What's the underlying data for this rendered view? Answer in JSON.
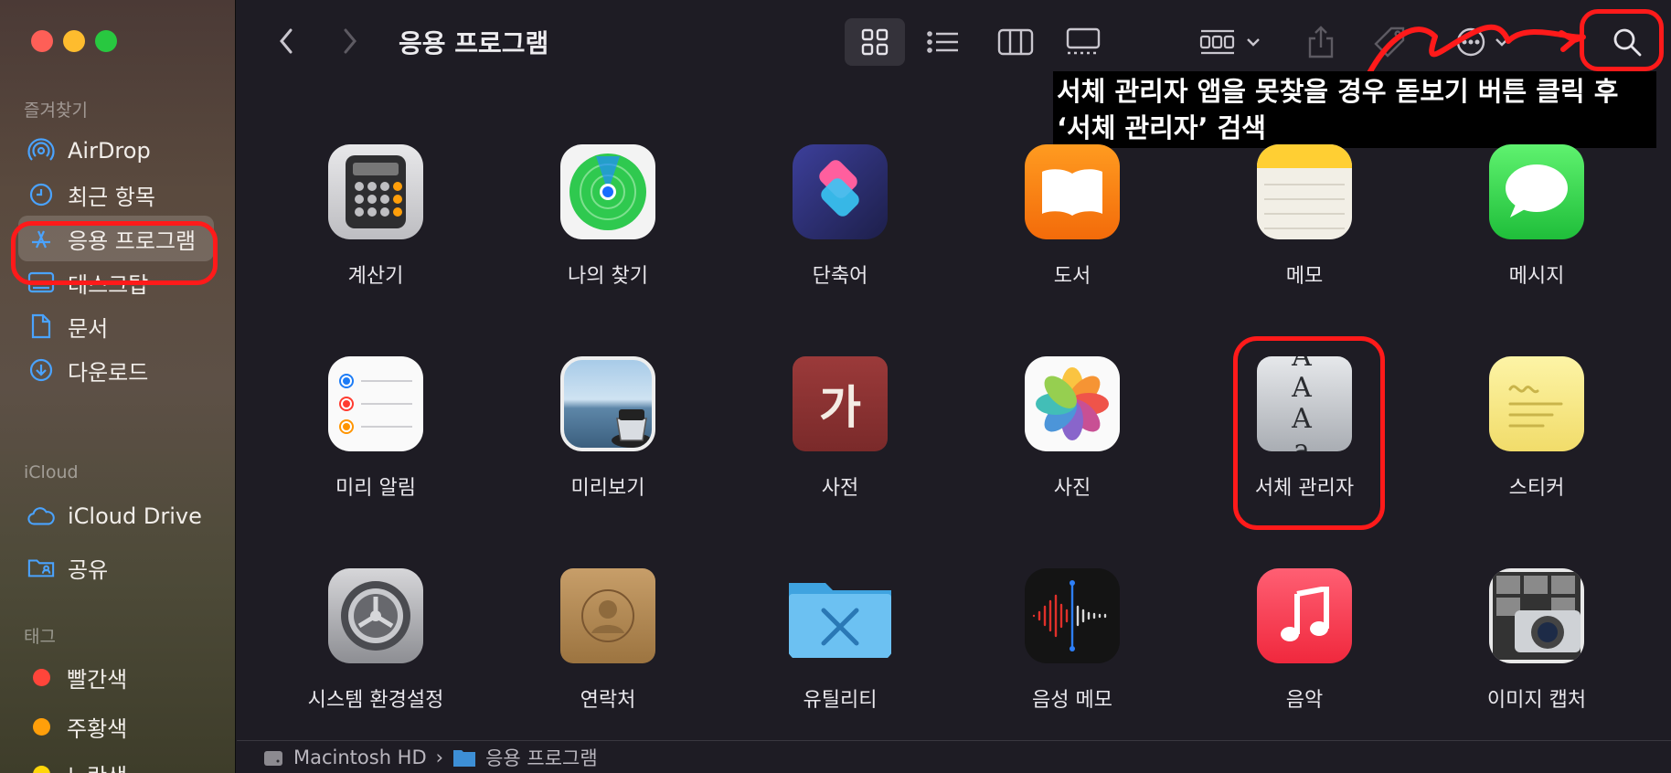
{
  "window": {
    "title": "응용 프로그램"
  },
  "sidebar": {
    "favorites_header": "즐겨찾기",
    "favorites": [
      {
        "label": "AirDrop",
        "icon": "airdrop-icon"
      },
      {
        "label": "최근 항목",
        "icon": "clock-icon"
      },
      {
        "label": "응용 프로그램",
        "icon": "applications-icon",
        "selected": true
      },
      {
        "label": "데스크탑",
        "icon": "desktop-icon"
      },
      {
        "label": "문서",
        "icon": "document-icon"
      },
      {
        "label": "다운로드",
        "icon": "download-icon"
      }
    ],
    "icloud_header": "iCloud",
    "icloud": [
      {
        "label": "iCloud Drive",
        "icon": "cloud-icon"
      },
      {
        "label": "공유",
        "icon": "shared-folder-icon"
      }
    ],
    "tags_header": "태그",
    "tags": [
      {
        "label": "빨간색",
        "color": "#ff453a"
      },
      {
        "label": "주황색",
        "color": "#ff9f0a"
      },
      {
        "label": "노란색",
        "color": "#ffd60a"
      }
    ]
  },
  "annotation": {
    "text_line1": "서체 관리자 앱을 못찾을 경우 돋보기 버튼 클릭 후",
    "text_line2": "‘서체 관리자’ 검색",
    "color": "#ff1a1a"
  },
  "apps": [
    {
      "label": "계산기",
      "icon": "calculator-icon"
    },
    {
      "label": "나의 찾기",
      "icon": "find-my-icon"
    },
    {
      "label": "단축어",
      "icon": "shortcuts-icon"
    },
    {
      "label": "도서",
      "icon": "books-icon"
    },
    {
      "label": "메모",
      "icon": "notes-icon"
    },
    {
      "label": "메시지",
      "icon": "messages-icon"
    },
    {
      "label": "미리 알림",
      "icon": "reminders-icon"
    },
    {
      "label": "미리보기",
      "icon": "preview-icon"
    },
    {
      "label": "사전",
      "icon": "dictionary-icon",
      "glyph": "가"
    },
    {
      "label": "사진",
      "icon": "photos-icon"
    },
    {
      "label": "서체 관리자",
      "icon": "font-book-icon",
      "glyph": "A A A a",
      "highlighted": true
    },
    {
      "label": "스티커",
      "icon": "stickies-icon"
    },
    {
      "label": "시스템 환경설정",
      "icon": "system-preferences-icon"
    },
    {
      "label": "연락처",
      "icon": "contacts-icon"
    },
    {
      "label": "유틸리티",
      "icon": "utilities-folder-icon"
    },
    {
      "label": "음성 메모",
      "icon": "voice-memos-icon"
    },
    {
      "label": "음악",
      "icon": "music-icon"
    },
    {
      "label": "이미지 캡처",
      "icon": "image-capture-icon"
    }
  ],
  "pathbar": {
    "disk": "Macintosh HD",
    "separator": "›",
    "folder": "응용 프로그램"
  }
}
